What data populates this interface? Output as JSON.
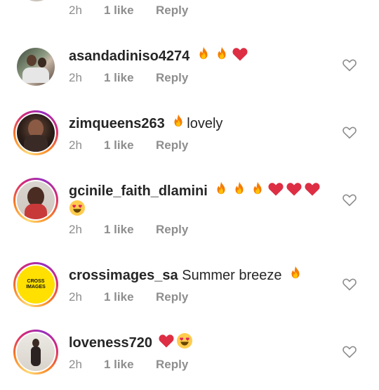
{
  "top": {
    "time": "2h",
    "likes": "1 like",
    "reply": "Reply"
  },
  "comments": [
    {
      "username": "asandadiniso4274",
      "text": "",
      "time": "2h",
      "likes": "1 like",
      "reply": "Reply"
    },
    {
      "username": "zimqueens263",
      "text": "lovely",
      "time": "2h",
      "likes": "1 like",
      "reply": "Reply"
    },
    {
      "username": "gcinile_faith_dlamini",
      "text": "",
      "time": "2h",
      "likes": "1 like",
      "reply": "Reply"
    },
    {
      "username": "crossimages_sa",
      "text": "Summer breeze",
      "time": "2h",
      "likes": "1 like",
      "reply": "Reply",
      "avatar_logo": "CROSS IMAGES"
    },
    {
      "username": "loveness720",
      "text": "",
      "time": "2h",
      "likes": "1 like",
      "reply": "Reply"
    }
  ],
  "icons": {
    "fire": "fire-emoji",
    "red_heart": "red-heart-emoji",
    "heart_eyes": "heart-eyes-emoji",
    "like": "heart-outline-icon"
  },
  "colors": {
    "text": "#262626",
    "meta": "#8e8e8e",
    "logo_bg": "#ffe000"
  }
}
